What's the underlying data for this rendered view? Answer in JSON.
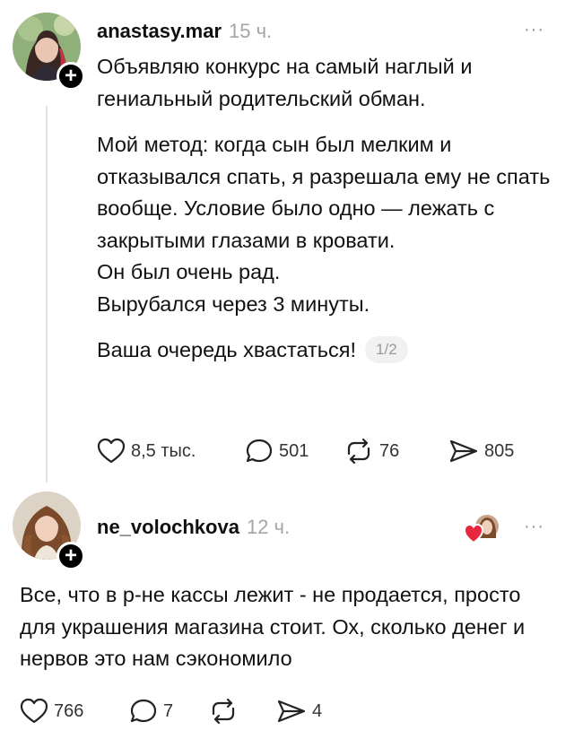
{
  "post1": {
    "username": "anastasy.mar",
    "time": "15 ч.",
    "more": "···",
    "paragraphs": [
      "Объявляю конкурс на самый наглый и гениальный родительский обман.",
      "Мой метод: когда сын был мелким и отказывался спать, я разрешала ему не спать вообще. Условие было одно — лежать с закрытыми глазами в кровати.",
      "Он был очень рад.",
      "Вырубался через 3 минуты.",
      "Ваша очередь хвастаться!"
    ],
    "pager": "1/2",
    "actions": {
      "likes": "8,5 тыс.",
      "comments": "501",
      "reposts": "76",
      "shares": "805"
    }
  },
  "post2": {
    "username": "ne_volochkova",
    "time": "12 ч.",
    "more": "···",
    "text": "Все, что в р-не кассы лежит - не продается, просто для украшения магазина стоит. Ох, сколько денег и нервов это нам сэкономило",
    "actions": {
      "likes": "766",
      "comments": "7",
      "reposts": "",
      "shares": "4"
    }
  },
  "icons": {
    "follow": "+",
    "like": "heart-icon",
    "comment": "speech-bubble-icon",
    "repost": "repost-arrows-icon",
    "share": "send-icon"
  },
  "colors": {
    "liked_heart": "#e8263e",
    "muted_text": "#a5a5a5"
  }
}
